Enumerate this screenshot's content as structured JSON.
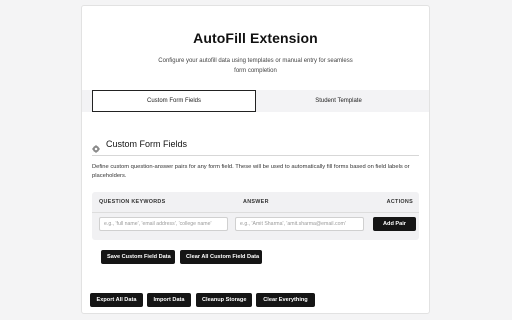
{
  "header": {
    "title": "AutoFill Extension",
    "subtitle": "Configure your autofill data using templates or manual entry for seamless form completion"
  },
  "tabs": [
    {
      "label": "Custom Form Fields",
      "active": true
    },
    {
      "label": "Student Template",
      "active": false
    }
  ],
  "section": {
    "title": "Custom Form Fields",
    "icon": "gear-icon",
    "description": "Define custom question-answer pairs for any form field. These will be used to automatically fill forms based on field labels or placeholders."
  },
  "table": {
    "headers": {
      "question": "QUESTION KEYWORDS",
      "answer": "ANSWER",
      "actions": "ACTIONS"
    },
    "question_placeholder": "e.g., 'full name', 'email address', 'college name'",
    "answer_placeholder": "e.g., 'Amit Sharma', 'amit.sharma@email.com'",
    "add_label": "Add Pair"
  },
  "custom_actions": {
    "save_label": "Save Custom Field Data",
    "clear_label": "Clear All Custom Field Data"
  },
  "footer_actions": {
    "export_label": "Export All Data",
    "import_label": "Import Data",
    "cleanup_label": "Cleanup Storage",
    "clear_everything_label": "Clear Everything"
  },
  "colors": {
    "primary": "#151515",
    "tab_bg": "#f3f3f5",
    "table_bg": "#f1f1f3"
  }
}
